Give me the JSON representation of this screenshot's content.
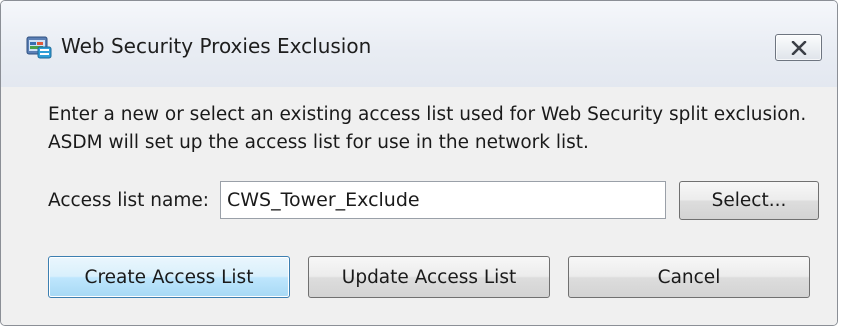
{
  "window": {
    "title": "Web Security Proxies Exclusion",
    "icon": "asdm-app-icon",
    "close_icon": "close-x-icon"
  },
  "description": "Enter a new or select an existing access list used for Web Security split exclusion. ASDM will set up the access list for use in the network list.",
  "access_list": {
    "label": "Access list name:",
    "value": "CWS_Tower_Exclude",
    "select_button": "Select..."
  },
  "buttons": {
    "create": "Create Access List",
    "update": "Update Access List",
    "cancel": "Cancel"
  },
  "colors": {
    "default_button_border": "#3c7fb1",
    "default_button_fill": "#bee6fd"
  }
}
